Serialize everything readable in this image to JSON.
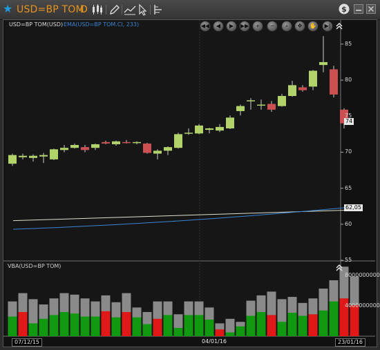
{
  "window": {
    "symbol": "USD=BP TOM",
    "periodicity": "D",
    "colors": {
      "accent": "#e8941c",
      "star": "#1e9be0"
    }
  },
  "toolbar": {
    "icons": [
      "star-icon",
      "candlestick-icon",
      "pencil-icon",
      "trend-tools-icon",
      "cursor-icon",
      "crosshair-icon",
      "currency-icon",
      "minimize-icon",
      "close-icon"
    ]
  },
  "legend": {
    "price_label": "USD=BP TOM(USD)",
    "ema_label": "EMA(USD=BP TOM.Cl, 233)",
    "volume_label": "VBA(USD=BP TOM)"
  },
  "navigation": {
    "buttons": [
      "first",
      "back",
      "play",
      "forward",
      "last",
      "zoom-in",
      "zoom-out",
      "search",
      "fit",
      "pan",
      "end"
    ]
  },
  "chart_data": {
    "type": "candlestick",
    "price_axis": {
      "ticks": [
        "85",
        "80",
        "75",
        "70",
        "65",
        "60",
        "55"
      ],
      "ylim": [
        55,
        87
      ],
      "position": "right"
    },
    "volume_axis": {
      "ticks": [
        "8000000000",
        "4000000000"
      ],
      "ylim": [
        0,
        9500000000
      ],
      "position": "right"
    },
    "dates": [
      "07/12/15",
      "04/01/16",
      "23/01/16"
    ],
    "last_price_label": "74",
    "ema_value_label": "62,05",
    "candles": [
      {
        "o": 68.4,
        "h": 69.8,
        "l": 68.1,
        "c": 69.6
      },
      {
        "o": 69.3,
        "h": 69.8,
        "l": 69.0,
        "c": 69.5
      },
      {
        "o": 69.2,
        "h": 69.7,
        "l": 68.7,
        "c": 69.5
      },
      {
        "o": 69.4,
        "h": 69.9,
        "l": 68.5,
        "c": 69.6
      },
      {
        "o": 69.0,
        "h": 70.5,
        "l": 68.9,
        "c": 70.4
      },
      {
        "o": 70.3,
        "h": 71.0,
        "l": 70.0,
        "c": 70.6
      },
      {
        "o": 70.6,
        "h": 71.2,
        "l": 70.5,
        "c": 71.0
      },
      {
        "o": 70.7,
        "h": 71.0,
        "l": 70.0,
        "c": 70.3
      },
      {
        "o": 70.6,
        "h": 71.2,
        "l": 70.3,
        "c": 71.1
      },
      {
        "o": 71.4,
        "h": 71.6,
        "l": 71.1,
        "c": 71.2
      },
      {
        "o": 71.1,
        "h": 71.6,
        "l": 70.9,
        "c": 71.5
      },
      {
        "o": 71.4,
        "h": 71.7,
        "l": 71.2,
        "c": 71.3
      },
      {
        "o": 71.3,
        "h": 71.5,
        "l": 71.1,
        "c": 71.4
      },
      {
        "o": 71.2,
        "h": 71.3,
        "l": 69.8,
        "c": 69.9
      },
      {
        "o": 69.8,
        "h": 70.4,
        "l": 69.0,
        "c": 70.2
      },
      {
        "o": 70.2,
        "h": 70.8,
        "l": 69.6,
        "c": 70.7
      },
      {
        "o": 70.6,
        "h": 72.7,
        "l": 70.5,
        "c": 72.5
      },
      {
        "o": 72.6,
        "h": 73.3,
        "l": 72.4,
        "c": 72.7
      },
      {
        "o": 72.6,
        "h": 73.9,
        "l": 72.5,
        "c": 73.7
      },
      {
        "o": 73.1,
        "h": 73.4,
        "l": 72.6,
        "c": 73.3
      },
      {
        "o": 73.0,
        "h": 73.9,
        "l": 72.8,
        "c": 73.5
      },
      {
        "o": 73.3,
        "h": 75.1,
        "l": 73.2,
        "c": 74.8
      },
      {
        "o": 75.7,
        "h": 76.6,
        "l": 75.1,
        "c": 76.4
      },
      {
        "o": 77.1,
        "h": 77.5,
        "l": 75.9,
        "c": 77.2
      },
      {
        "o": 76.5,
        "h": 77.3,
        "l": 75.9,
        "c": 76.6
      },
      {
        "o": 76.7,
        "h": 77.1,
        "l": 75.6,
        "c": 75.9
      },
      {
        "o": 76.4,
        "h": 78.1,
        "l": 76.3,
        "c": 77.8
      },
      {
        "o": 77.8,
        "h": 79.9,
        "l": 77.7,
        "c": 79.3
      },
      {
        "o": 79.0,
        "h": 79.3,
        "l": 78.4,
        "c": 78.6
      },
      {
        "o": 79.1,
        "h": 81.4,
        "l": 78.6,
        "c": 81.3
      },
      {
        "o": 82.1,
        "h": 86.1,
        "l": 81.1,
        "c": 82.5
      },
      {
        "o": 81.5,
        "h": 82.0,
        "l": 77.6,
        "c": 78.0
      },
      {
        "o": 75.9,
        "h": 76.1,
        "l": 73.3,
        "c": 74.0
      }
    ],
    "volume": {
      "totals": [
        4.6,
        5.7,
        4.9,
        4.2,
        5.0,
        5.7,
        5.5,
        5.0,
        4.6,
        5.4,
        4.5,
        5.7,
        3.8,
        3.2,
        4.6,
        4.6,
        2.9,
        4.6,
        4.6,
        3.8,
        1.7,
        2.3,
        1.9,
        4.7,
        5.4,
        5.9,
        4.9,
        5.2,
        4.4,
        5.0,
        6.3,
        7.4,
        9.2,
        7.9
      ],
      "colored": [
        2.6,
        3.2,
        1.7,
        2.3,
        2.8,
        3.2,
        3.0,
        2.6,
        2.6,
        3.3,
        2.5,
        3.2,
        2.5,
        1.6,
        2.3,
        2.8,
        1.1,
        2.8,
        2.8,
        2.2,
        0.9,
        0.5,
        1.3,
        2.7,
        3.2,
        2.8,
        1.9,
        3.1,
        2.7,
        2.9,
        3.4,
        4.6,
        5.0,
        4.1
      ],
      "colored_color": [
        "green",
        "red",
        "green",
        "green",
        "green",
        "green",
        "green",
        "green",
        "green",
        "red",
        "green",
        "red",
        "green",
        "green",
        "red",
        "green",
        "green",
        "green",
        "green",
        "green",
        "red",
        "green",
        "green",
        "green",
        "green",
        "red",
        "green",
        "green",
        "green",
        "red",
        "green",
        "green",
        "red",
        "red"
      ],
      "scale": 1000000000
    },
    "ema": {
      "x": [
        0,
        33
      ],
      "y": [
        59.3,
        62.5
      ],
      "color": "#3a86d4"
    },
    "reference_line": {
      "x": [
        0,
        33
      ],
      "y": [
        60.5,
        62.0
      ],
      "color": "#e0e0d0"
    },
    "colors": {
      "up": "#b2d36a",
      "down": "#cc4f52",
      "volume_gray": "#8a8a8a",
      "volume_green": "#119911",
      "volume_red": "#e01818",
      "ema": "#3a86d4"
    },
    "grid": true,
    "legend": "top-left"
  }
}
